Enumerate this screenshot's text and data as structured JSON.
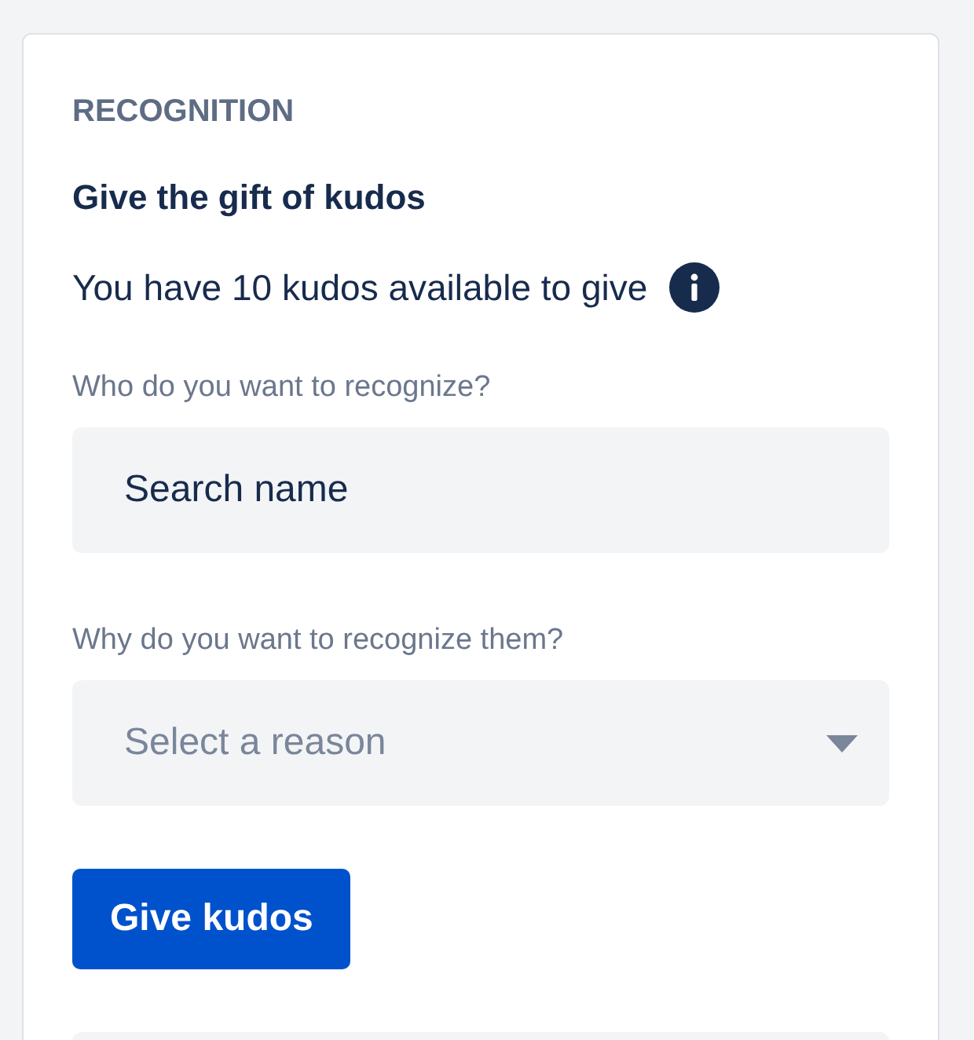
{
  "section_label": "RECOGNITION",
  "title": "Give the gift of kudos",
  "availability": "You have 10 kudos available to give",
  "fields": [
    {
      "kind": "search",
      "label": "Who do you want to recognize?",
      "value": "Search name"
    },
    {
      "kind": "select",
      "label": "Why do you want to recognize them?",
      "placeholder": "Select a reason"
    }
  ],
  "submit_button": "Give kudos"
}
